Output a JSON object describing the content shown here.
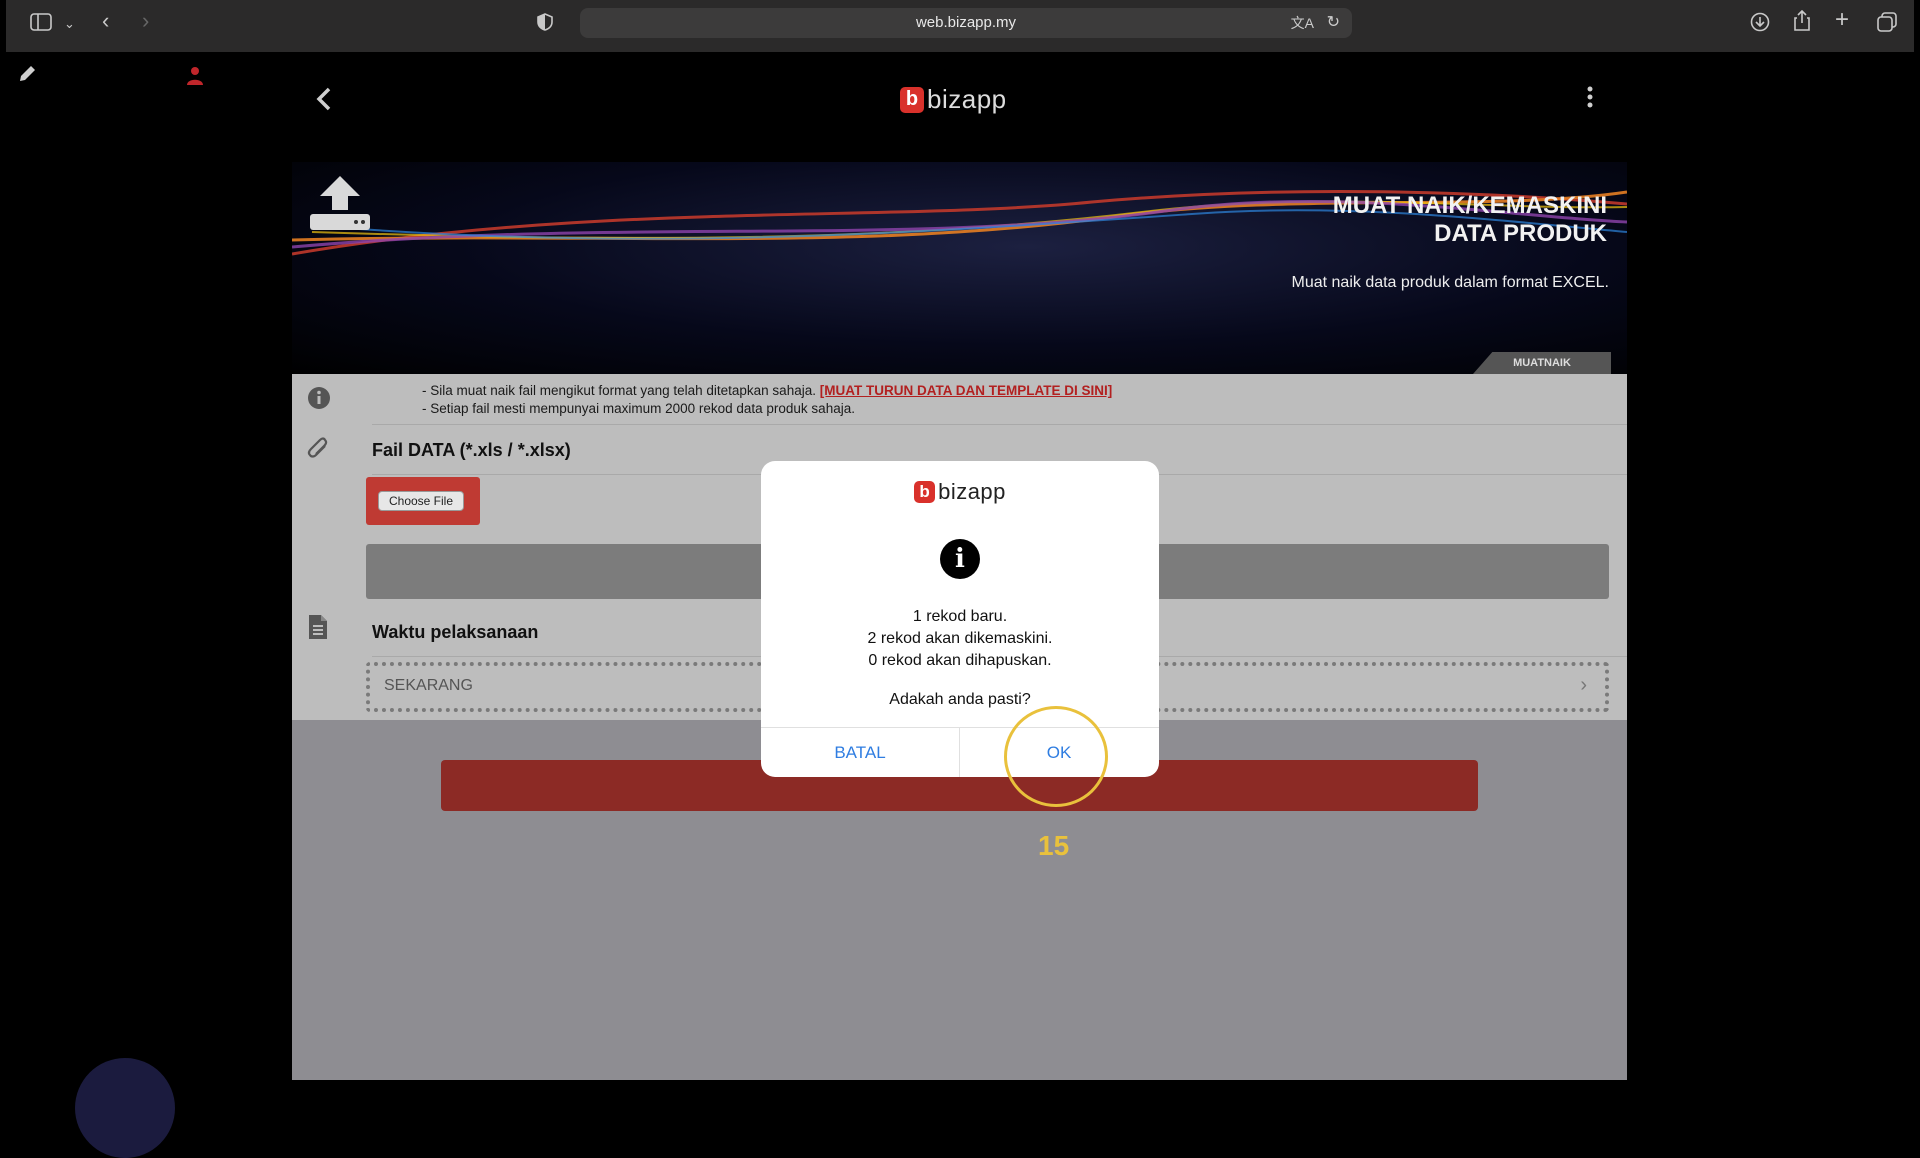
{
  "browser": {
    "url": "web.bizapp.my"
  },
  "app": {
    "logo_letter": "b",
    "logo_text": "bizapp",
    "banner": {
      "title_line1": "MUAT NAIK/KEMASKINI",
      "title_line2": "DATA PRODUK",
      "subtitle": "Muat naik data produk dalam format EXCEL.",
      "tab_label": "MUATNAIK"
    },
    "info": {
      "line1_prefix": "- Sila muat naik fail mengikut format yang telah ditetapkan sahaja.",
      "line1_link": "[MUAT TURUN DATA DAN TEMPLATE DI SINI]",
      "line2": "- Setiap fail mesti mempunyai maximum 2000 rekod data produk sahaja."
    },
    "file_section": {
      "label": "Fail DATA (*.xls / *.xlsx)",
      "choose_button": "Choose File"
    },
    "time_section": {
      "label": "Waktu pelaksanaan",
      "value": "SEKARANG"
    }
  },
  "dialog": {
    "logo_letter": "b",
    "logo_text": "bizapp",
    "line1": "1 rekod baru.",
    "line2": "2 rekod akan dikemaskini.",
    "line3": "0 rekod akan dihapuskan.",
    "question": "Adakah anda pasti?",
    "cancel_label": "BATAL",
    "ok_label": "OK"
  },
  "annotation": {
    "step_number": "15",
    "highlight_color": "#e9c13c"
  },
  "colors": {
    "brand_red": "#d9312b",
    "dialog_button": "#2f7de1"
  }
}
